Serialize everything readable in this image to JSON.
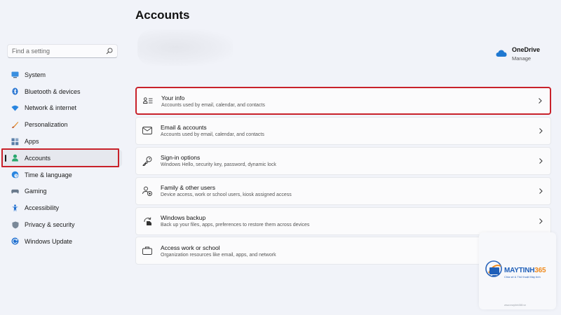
{
  "search": {
    "placeholder": "Find a setting"
  },
  "sidebar": {
    "items": [
      {
        "label": "System",
        "icon": "monitor-icon",
        "active": false
      },
      {
        "label": "Bluetooth & devices",
        "icon": "bluetooth-icon",
        "active": false
      },
      {
        "label": "Network & internet",
        "icon": "wifi-icon",
        "active": false
      },
      {
        "label": "Personalization",
        "icon": "brush-icon",
        "active": false
      },
      {
        "label": "Apps",
        "icon": "apps-icon",
        "active": false
      },
      {
        "label": "Accounts",
        "icon": "person-icon",
        "active": true
      },
      {
        "label": "Time & language",
        "icon": "globe-clock-icon",
        "active": false
      },
      {
        "label": "Gaming",
        "icon": "gamepad-icon",
        "active": false
      },
      {
        "label": "Accessibility",
        "icon": "accessibility-icon",
        "active": false
      },
      {
        "label": "Privacy & security",
        "icon": "shield-icon",
        "active": false
      },
      {
        "label": "Windows Update",
        "icon": "update-icon",
        "active": false
      }
    ]
  },
  "header": {
    "title": "Accounts"
  },
  "onedrive": {
    "title": "OneDrive",
    "action": "Manage",
    "icon": "cloud-icon"
  },
  "cards": [
    {
      "title": "Your info",
      "subtitle": "Accounts used by email, calendar, and contacts",
      "icon": "id-card-icon",
      "highlighted": true
    },
    {
      "title": "Email & accounts",
      "subtitle": "Accounts used by email, calendar, and contacts",
      "icon": "mail-icon",
      "highlighted": false
    },
    {
      "title": "Sign-in options",
      "subtitle": "Windows Hello, security key, password, dynamic lock",
      "icon": "key-icon",
      "highlighted": false
    },
    {
      "title": "Family & other users",
      "subtitle": "Device access, work or school users, kiosk assigned access",
      "icon": "people-icon",
      "highlighted": false
    },
    {
      "title": "Windows backup",
      "subtitle": "Back up your files, apps, preferences to restore them across devices",
      "icon": "backup-icon",
      "highlighted": false
    },
    {
      "title": "Access work or school",
      "subtitle": "Organization resources like email, apps, and network",
      "icon": "briefcase-icon",
      "highlighted": false
    }
  ],
  "watermark": {
    "brand_main": "MAYTINH",
    "brand_num": "365",
    "tagline": "Chia sẻ & Thủ thuật Máy tính",
    "footer": "www.maytinh365.vn"
  },
  "colors": {
    "accent": "#0067c0",
    "highlight": "#c8212a",
    "background": "#f1f3f9"
  }
}
